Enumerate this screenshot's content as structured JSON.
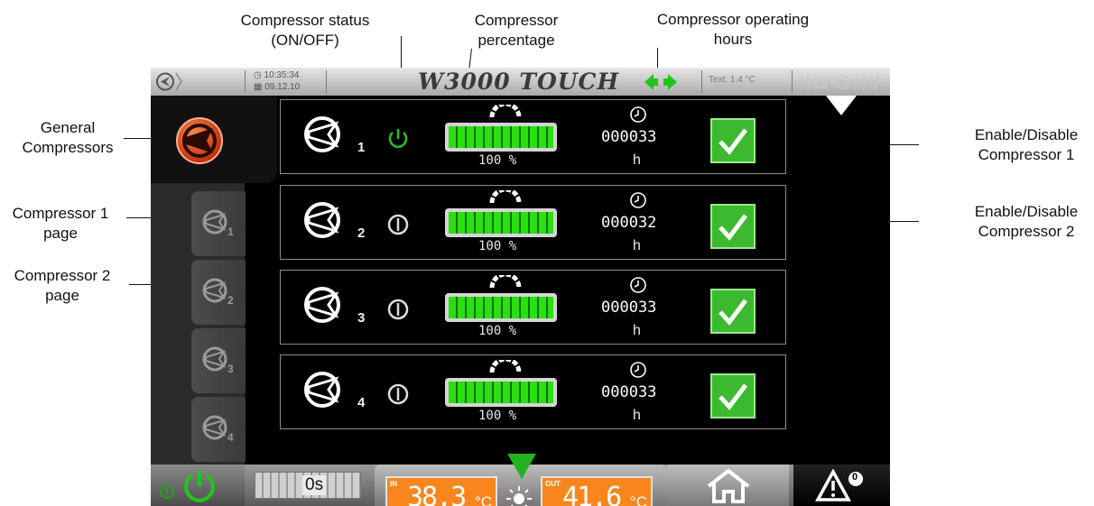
{
  "annotations": {
    "status": [
      "Compressor status",
      "(ON/OFF)"
    ],
    "percentage": [
      "Compressor",
      "percentage"
    ],
    "hours": [
      "Compressor operating",
      "hours"
    ],
    "general": [
      "General",
      "Compressors"
    ],
    "c1_page": [
      "Compressor 1",
      "page"
    ],
    "c2_page": [
      "Compressor 2",
      "page"
    ],
    "enable1": [
      "Enable/Disable",
      "Compressor 1"
    ],
    "enable2": [
      "Enable/Disable",
      "Compressor 2"
    ]
  },
  "topbar": {
    "time": "10:35:34",
    "date": "09.12.10",
    "title": "W3000 TOUCH",
    "ext_temp": "Text:  1.4 °C"
  },
  "sidebar": {
    "tabs": [
      {
        "sub": "1"
      },
      {
        "sub": "2"
      },
      {
        "sub": "3"
      },
      {
        "sub": "4"
      }
    ]
  },
  "compressors": [
    {
      "number": "1",
      "status": "ON",
      "percent": "100 %",
      "percent_value": 100,
      "hours": "000033",
      "hours_unit": "h",
      "enabled": true
    },
    {
      "number": "2",
      "status": "OFF",
      "percent": "100 %",
      "percent_value": 100,
      "hours": "000032",
      "hours_unit": "h",
      "enabled": true
    },
    {
      "number": "3",
      "status": "OFF",
      "percent": "100 %",
      "percent_value": 100,
      "hours": "000033",
      "hours_unit": "h",
      "enabled": true
    },
    {
      "number": "4",
      "status": "OFF",
      "percent": "100 %",
      "percent_value": 100,
      "hours": "000033",
      "hours_unit": "h",
      "enabled": true
    }
  ],
  "bottom": {
    "timer": "0s",
    "in_tag": "IN",
    "in_value": "38.3",
    "out_tag": "OUT",
    "out_value": "41.6",
    "temp_unit": "°C",
    "alarm_count": "0"
  },
  "colors": {
    "on": "#23c12a",
    "off": "#dcdcdc",
    "bar_fill": "#29e010",
    "check": "#3cba2f",
    "temp_box": "#f8861d"
  }
}
